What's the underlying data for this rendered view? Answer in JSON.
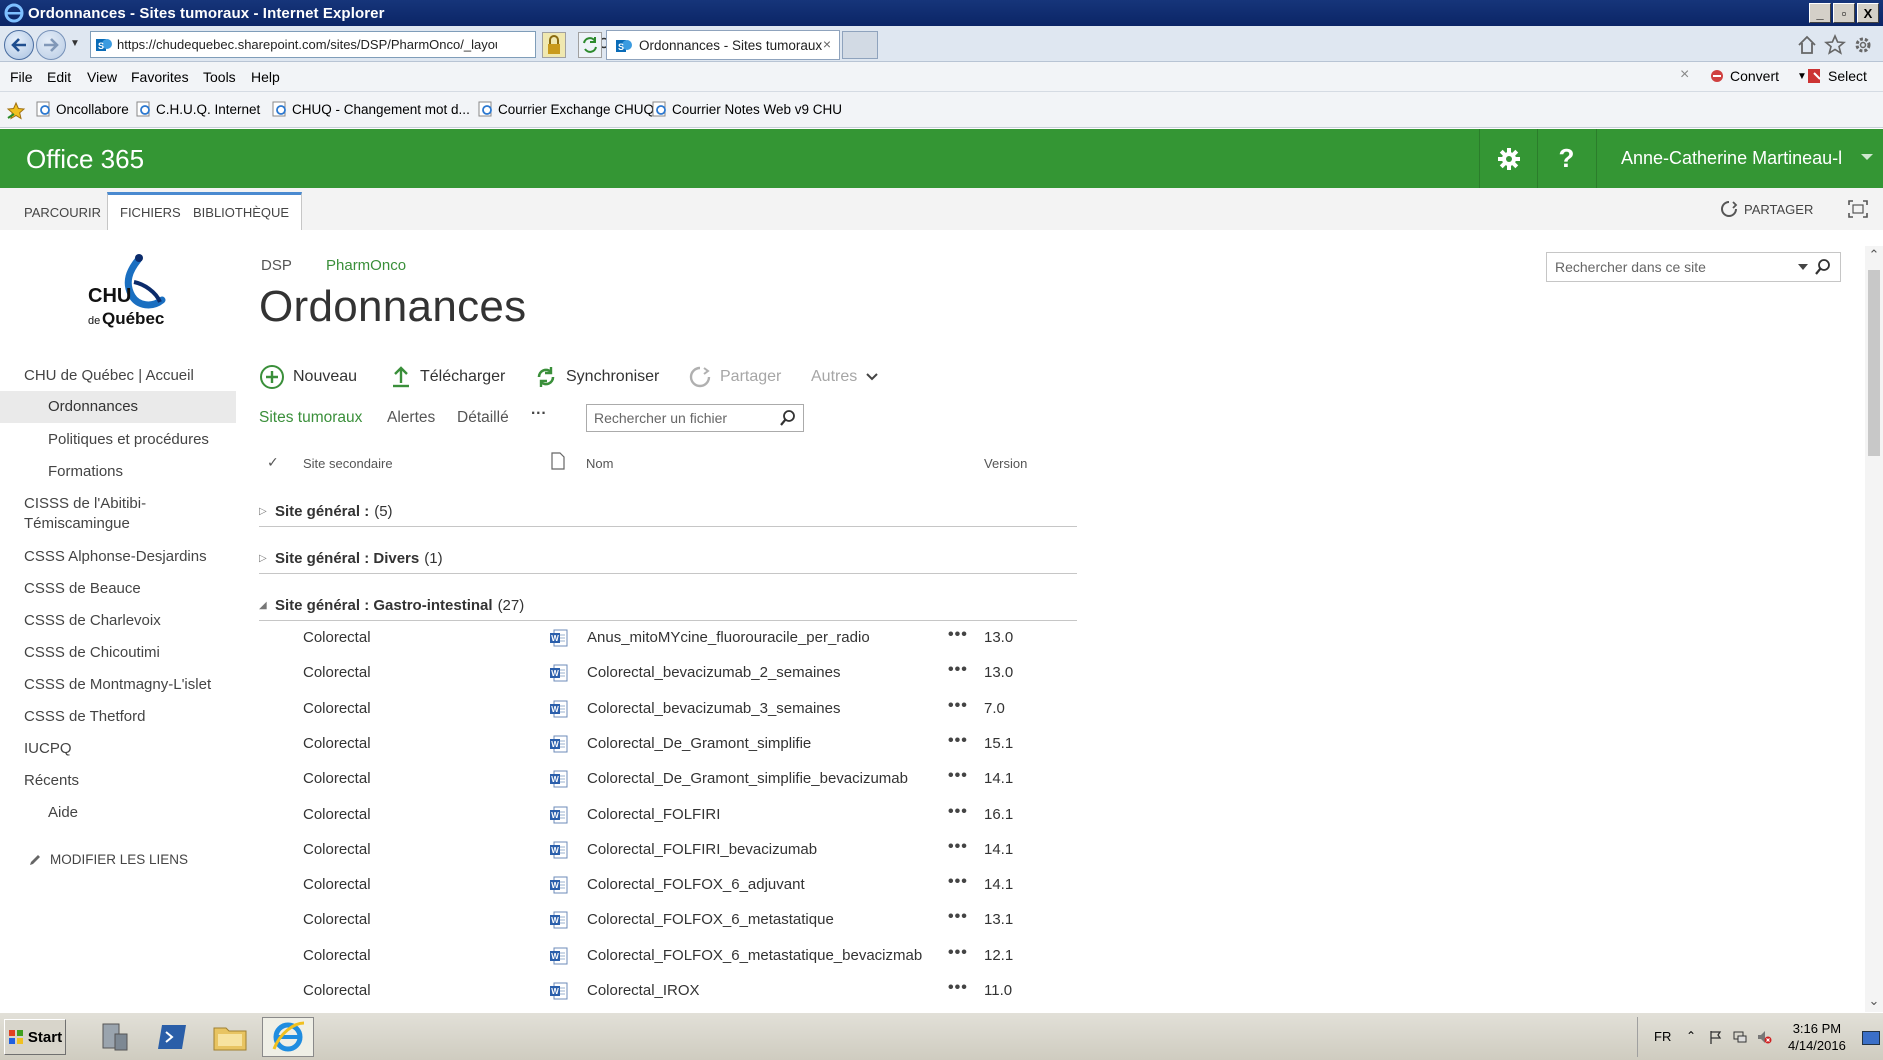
{
  "window": {
    "title": "Ordonnances - Sites tumoraux - Internet Explorer",
    "min": "_",
    "max": "▫",
    "close": "X"
  },
  "browser": {
    "url": "https://chudequebec.sharepoint.com/sites/DSP/PharmOnco/_layou",
    "tab_title": "Ordonnances - Sites tumoraux",
    "tab_close": "×",
    "menu": [
      "File",
      "Edit",
      "View",
      "Favorites",
      "Tools",
      "Help"
    ],
    "commands": {
      "convert": "Convert",
      "select": "Select",
      "close": "×"
    },
    "favorites": [
      "Oncollabore",
      "C.H.U.Q. Internet",
      "CHUQ - Changement mot d...",
      "Courrier Exchange CHUQ",
      "Courrier Notes Web v9 CHU"
    ]
  },
  "suite": {
    "brand": "Office 365",
    "help": "?",
    "user": "Anne-Catherine Martineau-l"
  },
  "ribbon": {
    "tabs": [
      "PARCOURIR",
      "FICHIERS",
      "BIBLIOTHÈQUE"
    ],
    "share": "PARTAGER"
  },
  "logo": {
    "line1": "CHU",
    "line2_small": "de",
    "line2": "Québec"
  },
  "leftnav": {
    "items": [
      {
        "label": "CHU de Québec | Accueil"
      },
      {
        "label": "Ordonnances"
      },
      {
        "label": "Politiques et procédures"
      },
      {
        "label": "Formations"
      },
      {
        "label": "CISSS de l'Abitibi-"
      },
      {
        "label": "Témiscamingue"
      },
      {
        "label": "CSSS Alphonse-Desjardins"
      },
      {
        "label": "CSSS de Beauce"
      },
      {
        "label": "CSSS de Charlevoix"
      },
      {
        "label": "CSSS de Chicoutimi"
      },
      {
        "label": "CSSS de Montmagny-L'islet"
      },
      {
        "label": "CSSS de Thetford"
      },
      {
        "label": "IUCPQ"
      },
      {
        "label": "Récents"
      },
      {
        "label": "Aide"
      }
    ],
    "edit_links": "MODIFIER LES LIENS"
  },
  "breadcrumb": {
    "parent": "DSP",
    "current": "PharmOnco"
  },
  "page_title": "Ordonnances",
  "site_search": {
    "placeholder": "Rechercher dans ce site"
  },
  "commandbar": {
    "new": "Nouveau",
    "upload": "Télécharger",
    "sync": "Synchroniser",
    "share": "Partager",
    "more": "Autres"
  },
  "views": {
    "sites": "Sites tumoraux",
    "alerts": "Alertes",
    "detailed": "Détaillé",
    "more": "···"
  },
  "file_search": {
    "placeholder": "Rechercher un fichier"
  },
  "columns": {
    "check": "✓",
    "site": "Site secondaire",
    "name": "Nom",
    "version": "Version"
  },
  "groups": [
    {
      "arrow": "▷",
      "label": "Site général :",
      "value": "",
      "count": "(5)"
    },
    {
      "arrow": "▷",
      "label": "Site général : Divers",
      "value": "",
      "count": "(1)"
    },
    {
      "arrow": "◢",
      "label": "Site général : Gastro-intestinal",
      "value": "",
      "count": "(27)"
    }
  ],
  "rows": [
    {
      "site": "Colorectal",
      "name": "Anus_mitoMYcine_fluorouracile_per_radio",
      "version": "13.0"
    },
    {
      "site": "Colorectal",
      "name": "Colorectal_bevacizumab_2_semaines",
      "version": "13.0"
    },
    {
      "site": "Colorectal",
      "name": "Colorectal_bevacizumab_3_semaines",
      "version": "7.0"
    },
    {
      "site": "Colorectal",
      "name": "Colorectal_De_Gramont_simplifie",
      "version": "15.1"
    },
    {
      "site": "Colorectal",
      "name": "Colorectal_De_Gramont_simplifie_bevacizumab",
      "version": "14.1"
    },
    {
      "site": "Colorectal",
      "name": "Colorectal_FOLFIRI",
      "version": "16.1"
    },
    {
      "site": "Colorectal",
      "name": "Colorectal_FOLFIRI_bevacizumab",
      "version": "14.1"
    },
    {
      "site": "Colorectal",
      "name": "Colorectal_FOLFOX_6_adjuvant",
      "version": "14.1"
    },
    {
      "site": "Colorectal",
      "name": "Colorectal_FOLFOX_6_metastatique",
      "version": "13.1"
    },
    {
      "site": "Colorectal",
      "name": "Colorectal_FOLFOX_6_metastatique_bevacizmab",
      "version": "12.1"
    },
    {
      "site": "Colorectal",
      "name": "Colorectal_IROX",
      "version": "11.0"
    }
  ],
  "row_menu": "•••",
  "taskbar": {
    "start": "Start",
    "lang": "FR",
    "time": "3:16 PM",
    "date": "4/14/2016"
  },
  "colors": {
    "suite_green": "#349634",
    "link_green": "#3a8f3a",
    "title_blue": "#0b2566"
  }
}
